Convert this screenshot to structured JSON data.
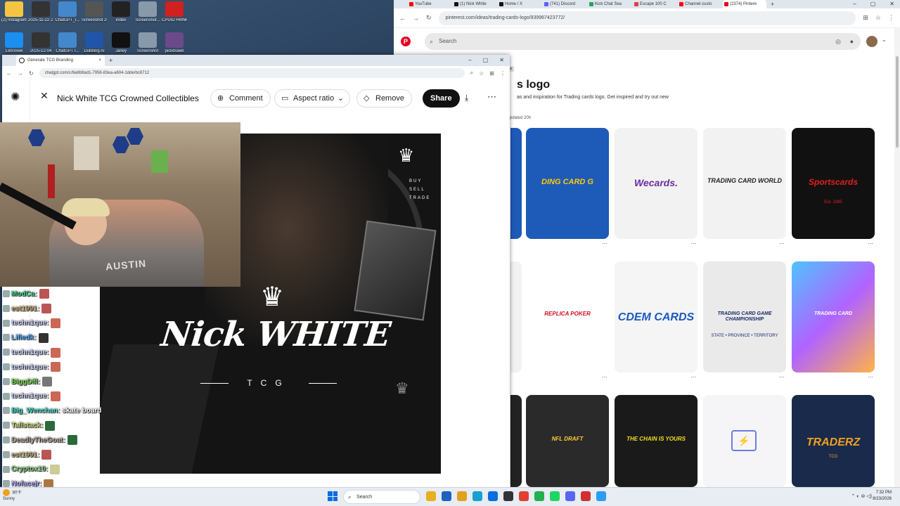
{
  "desktop": {
    "icons": [
      {
        "label": "(2) Instagram_...",
        "color": "#f5c542"
      },
      {
        "label": "2025-11-22 21-19-46",
        "color": "#333333"
      },
      {
        "label": "ChatGPT_I...",
        "color": "#4488cc"
      },
      {
        "label": "Screenshot 2026-08-...",
        "color": "#555555"
      },
      {
        "label": "index",
        "color": "#222222"
      },
      {
        "label": "Screenshot...",
        "color": "#8899aa"
      },
      {
        "label": "CPUID HWMonitor",
        "color": "#d02020"
      },
      {
        "label": "LetsView",
        "color": "#1a8ff0"
      },
      {
        "label": "2025-12-04",
        "color": "#333333"
      },
      {
        "label": "ChatGPT I...",
        "color": "#4488cc"
      },
      {
        "label": "Dubbing AI",
        "color": "#2255aa"
      },
      {
        "label": "Janey",
        "color": "#111111"
      },
      {
        "label": "Screenshot",
        "color": "#8899aa"
      },
      {
        "label": "pickdraw8",
        "color": "#6a4a8a"
      }
    ]
  },
  "pinterest_browser": {
    "tabs": [
      {
        "label": "YouTube",
        "color": "#ff0000"
      },
      {
        "label": "(1) Nick White",
        "color": "#111111"
      },
      {
        "label": "Home / X",
        "color": "#111111"
      },
      {
        "label": "(741) Discord",
        "color": "#5865f2"
      },
      {
        "label": "Kick Chat Sea",
        "color": "#23a559"
      },
      {
        "label": "Escape 100 C",
        "color": "#e04040"
      },
      {
        "label": "Channel custo",
        "color": "#ff0000"
      },
      {
        "label": "(2374) Pintere",
        "color": "#e60023"
      }
    ],
    "url": "pinterest.com/ideas/trading-cards-logo/939967423772/",
    "search_placeholder": "Search",
    "page_title": "s logo",
    "page_description": "as and inspiration for Trading cards logo. Get inspired and try out new",
    "updated_text": "pdated 20h",
    "chip": "ps",
    "pins": [
      {
        "label": "DING CARD G",
        "style": "pokemon"
      },
      {
        "label": "Wecards.",
        "style": "wecards"
      },
      {
        "label": "TRADING CARD WORLD",
        "style": "tcw"
      },
      {
        "label": "Sportscards",
        "sublabel": "Est. 1995",
        "style": "sports"
      },
      {
        "label": "REPLICA POKER",
        "style": "replica"
      },
      {
        "label": "CDEM CARDS",
        "style": "cdem"
      },
      {
        "label": "TRADING CARD GAME CHAMPIONSHIP",
        "sublabel": "STATE • PROVINCE • TERRITORY",
        "style": "champ"
      },
      {
        "label": "TRADING CARD",
        "style": "holo"
      },
      {
        "label": "NFL DRAFT",
        "style": "nfl"
      },
      {
        "label": "THE CHAIN IS YOURS",
        "style": "chain"
      },
      {
        "label": "",
        "style": "cardsicon"
      },
      {
        "label": "TRADERZ",
        "sublabel": "TCG",
        "style": "traderz"
      }
    ]
  },
  "chatgpt_browser": {
    "tab_title": "Generate TCG Branding",
    "url": "chatgpt.com/c/6a8b8ad1-7958-83ea-a604-1dde/bc8712",
    "image_title": "Nick White TCG Crowned Collectibles",
    "comment_label": "Comment",
    "aspect_label": "Aspect ratio",
    "remove_label": "Remove",
    "share_label": "Share"
  },
  "generated_image": {
    "tagline": [
      "BUY",
      "SELL",
      "TRADE"
    ],
    "brand": "Nick WHITE",
    "sub": "TCG"
  },
  "webcam": {
    "shirt_text": "AUSTIN"
  },
  "chat": [
    {
      "user": "ModCa",
      "color": "#3fd08a",
      "text": "",
      "emote": "#b55"
    },
    {
      "user": "est1991",
      "color": "#c9b27a",
      "text": "",
      "emote": "#b55"
    },
    {
      "user": "techn1que",
      "color": "#cfd3ff",
      "text": "",
      "emote": "#c65"
    },
    {
      "user": "Lifiedk",
      "color": "#5ab0ff",
      "text": "",
      "emote": "#333"
    },
    {
      "user": "techn1que",
      "color": "#cfd3ff",
      "text": "",
      "emote": "#c65"
    },
    {
      "user": "techn1que",
      "color": "#cfd3ff",
      "text": "",
      "emote": "#c65"
    },
    {
      "user": "BiggDill",
      "color": "#7fe05a",
      "text": "",
      "emote": "#777"
    },
    {
      "user": "techn1que",
      "color": "#cfd3ff",
      "text": "",
      "emote": "#c65"
    },
    {
      "user": "Big_Wenchan",
      "color": "#49e0d0",
      "text": "skate board",
      "emote": ""
    },
    {
      "user": "Tallstack",
      "color": "#d0e07a",
      "text": "",
      "emote": "#2a6a3a"
    },
    {
      "user": "DeadlyTheGoat",
      "color": "#b9a9a0",
      "text": "",
      "emote": "#2a6a3a"
    },
    {
      "user": "est1991",
      "color": "#c9b27a",
      "text": "",
      "emote": "#b55"
    },
    {
      "user": "Cryptox10",
      "color": "#7fd07a",
      "text": "",
      "emote": "#cc9"
    },
    {
      "user": "Nofacejr",
      "color": "#b9b0ff",
      "text": "",
      "emote": "#a74"
    }
  ],
  "taskbar": {
    "weather_temp": "80°F",
    "weather_desc": "Sunny",
    "search_label": "Search",
    "time": "7:32 PM",
    "date": "8/23/2026",
    "apps": [
      "#e8b020",
      "#2060c0",
      "#e0a020",
      "#1aa0d0",
      "#0a6ee0",
      "#333333",
      "#e04030",
      "#22b050",
      "#1ed760",
      "#5865f2",
      "#d03030",
      "#2a9df4"
    ]
  }
}
